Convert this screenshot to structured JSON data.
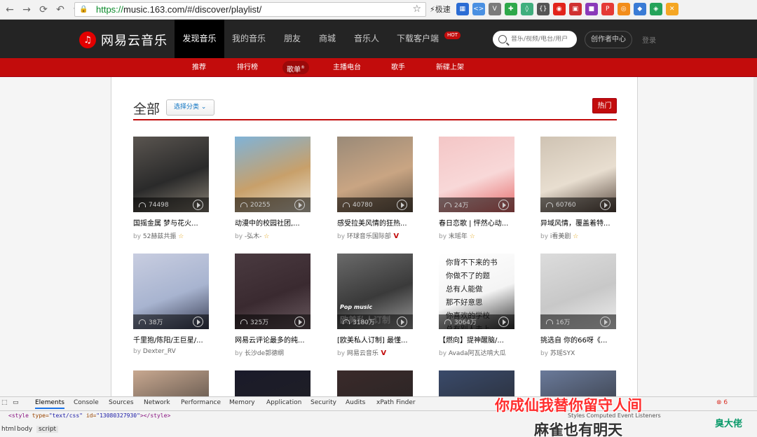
{
  "browser": {
    "url_scheme": "https://",
    "url_rest": "music.163.com/#/discover/playlist/",
    "speed_label": "极速",
    "extensions": [
      {
        "name": "windows-ext-icon",
        "color": "#2b6cd4",
        "glyph": "▦"
      },
      {
        "name": "code-ext-icon",
        "color": "#4a90e2",
        "glyph": "<>"
      },
      {
        "name": "v-ext-icon",
        "color": "#7a7a7a",
        "glyph": "V"
      },
      {
        "name": "green-ext-icon",
        "color": "#2ea84a",
        "glyph": "✚"
      },
      {
        "name": "vue-ext-icon",
        "color": "#3fae7d",
        "glyph": "◊"
      },
      {
        "name": "braces-ext-icon",
        "color": "#555555",
        "glyph": "{}"
      },
      {
        "name": "red-ext-icon",
        "color": "#e2231a",
        "glyph": "◉"
      },
      {
        "name": "cube-ext-icon",
        "color": "#d03030",
        "glyph": "▣"
      },
      {
        "name": "purple-ext-icon",
        "color": "#8a3ab9",
        "glyph": "■"
      },
      {
        "name": "pdf-ext-icon",
        "color": "#e53935",
        "glyph": "P"
      },
      {
        "name": "orange-ext-icon",
        "color": "#f28c1a",
        "glyph": "◎"
      },
      {
        "name": "blue-ext-icon",
        "color": "#3a7bd5",
        "glyph": "◆"
      },
      {
        "name": "shield-ext-icon",
        "color": "#25a35a",
        "glyph": "◈"
      },
      {
        "name": "x-ext-icon",
        "color": "#f5a623",
        "glyph": "✕"
      }
    ]
  },
  "nav": {
    "logo_text": "网易云音乐",
    "items": [
      "发现音乐",
      "我的音乐",
      "朋友",
      "商城",
      "音乐人",
      "下载客户端"
    ],
    "hot_badge": "HOT",
    "search_placeholder": "音乐/视频/电台/用户",
    "creator_label": "创作者中心",
    "login_label": "登录"
  },
  "subnav": {
    "items": [
      "推荐",
      "排行榜",
      "歌单",
      "主播电台",
      "歌手",
      "新碟上架"
    ],
    "active_sup": "®"
  },
  "main": {
    "title": "全部",
    "select_label": "选择分类",
    "hot_label": "热门",
    "by_prefix": "by",
    "playlists": [
      {
        "count": "74498",
        "name": "国摇金属 梦与花火...",
        "author": "52赫兹共振",
        "badge": "star",
        "c1": "#5a5550",
        "c2": "#2a2a2a",
        "c3": "#8a8275"
      },
      {
        "count": "20255",
        "name": "动漫中的校园社团,...",
        "author": "-弘木-",
        "badge": "star",
        "c1": "#7fb3d8",
        "c2": "#c8a06a",
        "c3": "#e8e0d0"
      },
      {
        "count": "40780",
        "name": "感受拉美风情的狂热...",
        "author": "环球音乐国际部",
        "badge": "v",
        "c1": "#9a8a78",
        "c2": "#c9a583",
        "c3": "#6a5a4a"
      },
      {
        "count": "24万",
        "name": "春日恋歌 | 怦然心动...",
        "author": "末瑶年",
        "badge": "star",
        "c1": "#f4c6c6",
        "c2": "#f8d8d8",
        "c3": "#e66a6a"
      },
      {
        "count": "60760",
        "name": "异域风情，覆盖着特...",
        "author": "i看美剧",
        "badge": "star",
        "c1": "#cfc3b3",
        "c2": "#e8ded0",
        "c3": "#5a4a40"
      },
      {
        "count": "38万",
        "name": "千里狍/陈阳/王巨星/...",
        "author": "Dexter_RV",
        "badge": "",
        "c1": "#c8cde0",
        "c2": "#a8b4d0",
        "c3": "#3a3f55"
      },
      {
        "count": "325万",
        "name": "网易云评论最多的纯...",
        "author": "长沙de郭德纲",
        "badge": "",
        "c1": "#4a3a40",
        "c2": "#3a2a30",
        "c3": "#6a5a60"
      },
      {
        "count": "3180万",
        "name": "[欧美私人订制] 最懂...",
        "author": "网易云音乐",
        "badge": "v",
        "c1": "#6a6a6a",
        "c2": "#3a3a3a",
        "c3": "#9a9a9a"
      },
      {
        "count": "3064万",
        "name": "【燃向】提神醒脑/...",
        "author": "Avada阿瓦达啃大瓜",
        "badge": "",
        "c1": "#ffffff",
        "c2": "#f4f4f4",
        "c3": "#333333"
      },
      {
        "count": "16万",
        "name": "挑选自 你的66呀《...",
        "author": "苏瑶SYX",
        "badge": "",
        "c1": "#dcdcdc",
        "c2": "#c8c8c8",
        "c3": "#eeeeee"
      }
    ],
    "text_cover_lines": [
      "你背不下来的书",
      "你做不了的题",
      "总有人能做",
      "那不好意思",
      "你喜欢的学校",
      "总有别人去上"
    ],
    "pop_label": "Pop music",
    "pop_sub": "欧美私人订制"
  },
  "devtools": {
    "tabs": [
      "Elements",
      "Console",
      "Sources",
      "Network",
      "Performance",
      "Memory",
      "Application",
      "Security",
      "Audits",
      "xPath Finder"
    ],
    "code_tag_open": "<style",
    "code_attr1": "type=",
    "code_val1": "\"text/css\"",
    "code_attr2": "id=",
    "code_val2": "\"13080327930\"",
    "code_tag_close": "></style>",
    "crumbs": [
      "html",
      "body",
      "script"
    ],
    "side": "Styles   Computed   Event Listeners",
    "error_count": "6"
  },
  "overlay": {
    "lyric1": "你成仙我替你留守人间",
    "lyric2": "麻雀也有明天",
    "watermark": "臭大佬"
  }
}
